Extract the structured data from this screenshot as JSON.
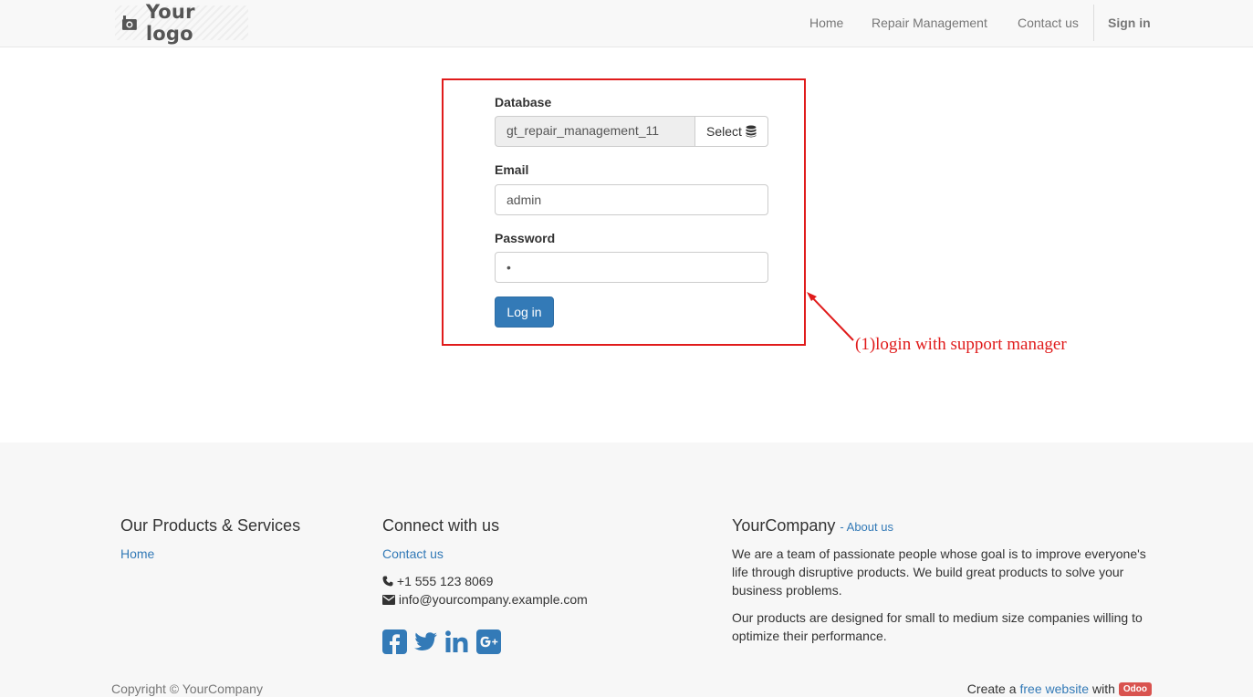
{
  "navbar": {
    "logo_text": "Your logo",
    "links": [
      "Home",
      "Repair Management",
      "Contact us"
    ],
    "signin": "Sign in"
  },
  "login": {
    "database_label": "Database",
    "database_value": "gt_repair_management_11",
    "select_label": "Select",
    "email_label": "Email",
    "email_value": "admin",
    "password_label": "Password",
    "password_value": "•",
    "login_button": "Log in"
  },
  "annotation": {
    "text": "(1)login with support manager",
    "color": "#e01b1b"
  },
  "footer": {
    "col1": {
      "heading": "Our Products & Services",
      "link": "Home"
    },
    "col2": {
      "heading": "Connect with us",
      "link": "Contact us",
      "phone": "+1 555 123 8069",
      "email": "info@yourcompany.example.com",
      "social": [
        "facebook-icon",
        "twitter-icon",
        "linkedin-icon",
        "google-plus-icon"
      ]
    },
    "col3": {
      "heading": "YourCompany",
      "about_link": "- About us",
      "para1": "We are a team of passionate people whose goal is to improve everyone's life through disruptive products. We build great products to solve your business problems.",
      "para2": "Our products are designed for small to medium size companies willing to optimize their performance."
    },
    "copyright": "Copyright © YourCompany",
    "create_prefix": "Create a",
    "create_link": "free website",
    "create_suffix": "with",
    "odoo_badge": "Odoo"
  },
  "colors": {
    "primary": "#337ab7",
    "annotation": "#e01b1b",
    "odoo_badge": "#d9534f"
  }
}
